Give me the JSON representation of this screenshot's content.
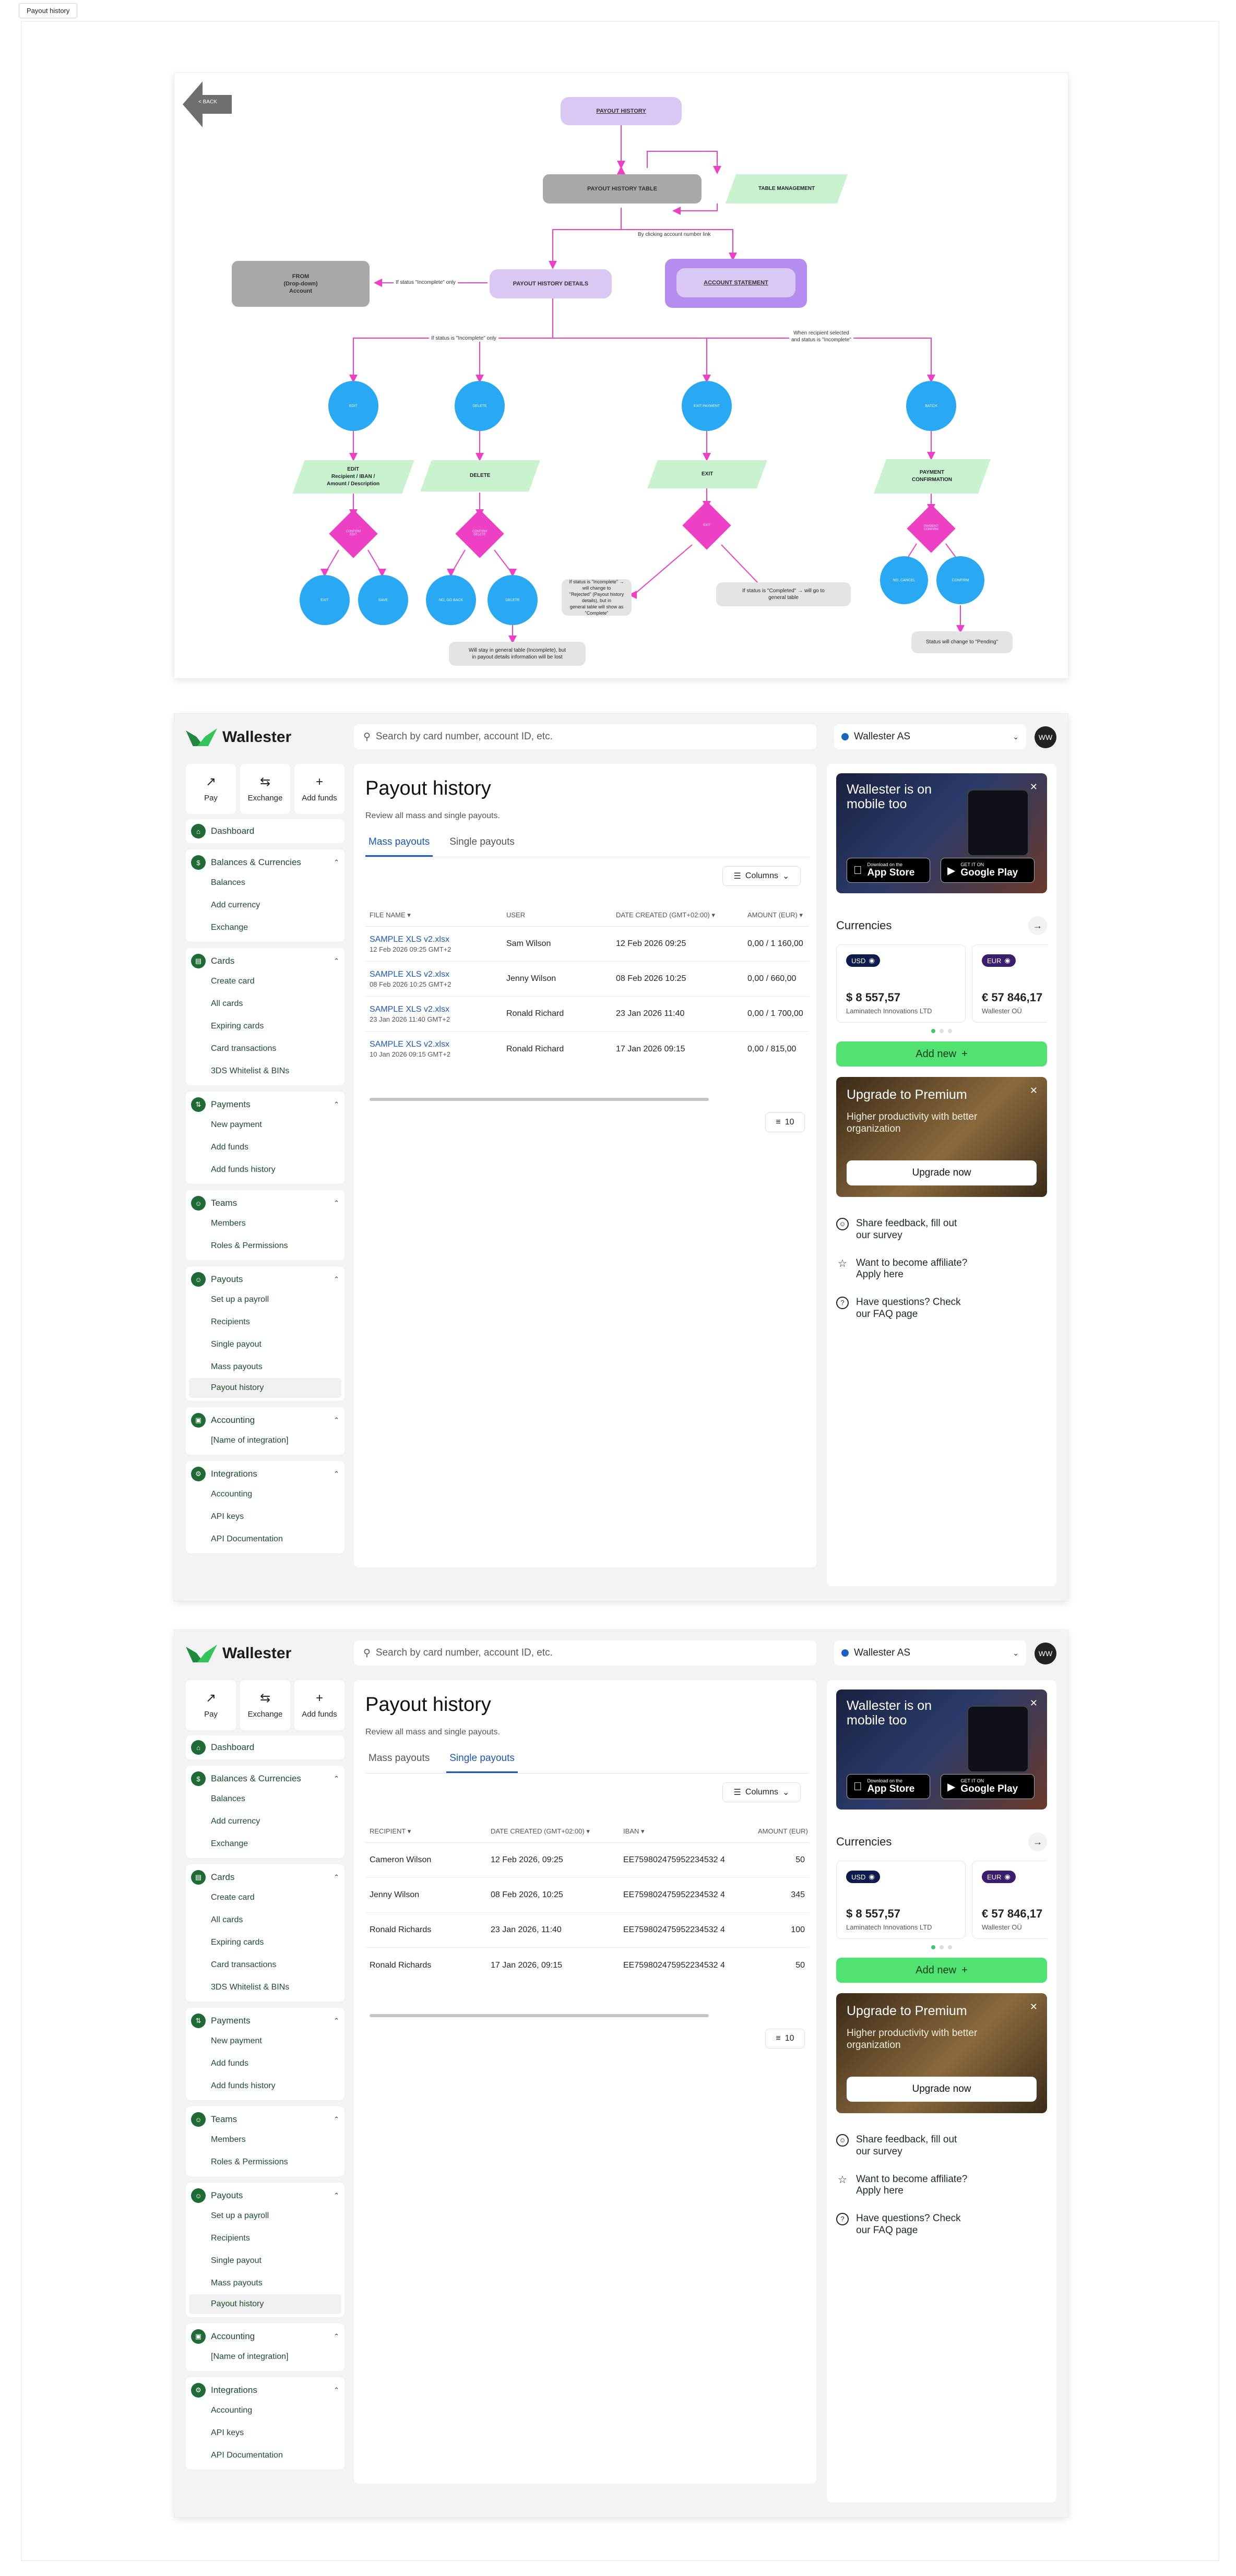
{
  "frame_label": "Payout history",
  "flow": {
    "back": "< BACK",
    "payout_history": "PAYOUT HISTORY",
    "payout_history_table": "PAYOUT HISTORY TABLE",
    "table_management": "TABLE MANAGEMENT",
    "by_clicking": "By clicking account number link",
    "from": "FROM\n(Drop-down)\nAccount",
    "if_incomplete_only": "If status \"Incomplete\" only",
    "payout_history_details": "PAYOUT HISTORY DETAILS",
    "account_statement": "ACCOUNT STATEMENT",
    "if_incomplete_only_2": "If status is \"Incomplete\" only",
    "when_recipient": "When recipient selected\nand status is \"Incomplete\"",
    "circles": [
      "EDIT",
      "DELETE",
      "EXIT PAYMENT",
      "BATCH"
    ],
    "edit_box": "EDIT\nRecipient / IBAN /\nAmount / Description",
    "delete_box": "DELETE",
    "exit_box": "EXIT",
    "payment_confirmation": "PAYMENT\nCONFIRMATION",
    "diamonds": [
      "CONFIRM\nEDIT",
      "CONFIRM\nDELETE",
      "EXIT",
      "PAYMENT\nCONFIRM"
    ],
    "bottom_circles": [
      "EXIT",
      "SAVE",
      "NO, GO BACK",
      "DELETE",
      "NO, CANCEL",
      "CONFIRM"
    ],
    "note_delete": "Will stay in general table (Incomplete), but\nin payout details information will be lost",
    "note_exit_incomplete": "If status is \"Incomplete\" → will change to\n\"Rejected\" (Payout history details), but in\ngeneral table will show as \"Complete\"",
    "note_exit_completed": "If status is \"Completed\" → will go to\ngeneral table",
    "note_pending": "Status will change to \"Pending\""
  },
  "app": {
    "brand": "Wallester",
    "search_placeholder": "Search by card number, account ID, etc.",
    "company": "Wallester AS",
    "avatar": "WW",
    "quick": [
      "Pay",
      "Exchange",
      "Add funds"
    ],
    "nav": {
      "dashboard": "Dashboard",
      "balances": "Balances & Currencies",
      "balances_items": [
        "Balances",
        "Add currency",
        "Exchange"
      ],
      "cards": "Cards",
      "cards_items": [
        "Create card",
        "All cards",
        "Expiring cards",
        "Card transactions",
        "3DS Whitelist & BINs"
      ],
      "payments": "Payments",
      "payments_items": [
        "New payment",
        "Add funds",
        "Add funds history"
      ],
      "teams": "Teams",
      "teams_items": [
        "Members",
        "Roles & Permissions"
      ],
      "payouts": "Payouts",
      "payouts_items": [
        "Set up a payroll",
        "Recipients",
        "Single payout",
        "Mass payouts",
        "Payout history"
      ],
      "accounting": "Accounting",
      "accounting_items": [
        "[Name of integration]"
      ],
      "integrations": "Integrations",
      "integrations_items": [
        "Accounting",
        "API keys",
        "API Documentation"
      ]
    },
    "page_title": "Payout history",
    "page_sub": "Review all mass and single payouts.",
    "tab_mass": "Mass payouts",
    "tab_single": "Single payouts",
    "columns": "Columns",
    "page_size": "10",
    "mass_headers": [
      "FILE NAME",
      "USER",
      "DATE CREATED (GMT+02:00)",
      "AMOUNT (EUR)"
    ],
    "mass_rows": [
      {
        "file": "SAMPLE XLS v2.xlsx",
        "date_small": "12 Feb 2026 09:25 GMT+2",
        "user": "Sam Wilson",
        "date": "12 Feb 2026 09:25",
        "amount": "0,00 / 1 160,00"
      },
      {
        "file": "SAMPLE XLS v2.xlsx",
        "date_small": "08 Feb 2026 10:25 GMT+2",
        "user": "Jenny Wilson",
        "date": "08 Feb 2026 10:25",
        "amount": "0,00 / 660,00"
      },
      {
        "file": "SAMPLE XLS v2.xlsx",
        "date_small": "23 Jan 2026 11:40 GMT+2",
        "user": "Ronald Richard",
        "date": "23 Jan 2026 11:40",
        "amount": "0,00 / 1 700,00"
      },
      {
        "file": "SAMPLE XLS v2.xlsx",
        "date_small": "10 Jan 2026 09:15 GMT+2",
        "user": "Ronald Richard",
        "date": "17 Jan 2026 09:15",
        "amount": "0,00 / 815,00"
      }
    ],
    "single_headers": [
      "RECIPIENT",
      "DATE CREATED (GMT+02:00)",
      "IBAN",
      "AMOUNT (EUR)"
    ],
    "single_rows": [
      {
        "recipient": "Cameron Wilson",
        "date": "12 Feb 2026, 09:25",
        "iban": "EE759802475952234532 4",
        "amount": "50"
      },
      {
        "recipient": "Jenny Wilson",
        "date": "08 Feb 2026, 10:25",
        "iban": "EE759802475952234532 4",
        "amount": "345"
      },
      {
        "recipient": "Ronald Richards",
        "date": "23 Jan 2026, 11:40",
        "iban": "EE759802475952234532 4",
        "amount": "100"
      },
      {
        "recipient": "Ronald Richards",
        "date": "17 Jan 2026, 09:15",
        "iban": "EE759802475952234532 4",
        "amount": "50"
      }
    ],
    "promo_title": "Wallester is on mobile too",
    "app_store_top": "Download on the",
    "app_store": "App Store",
    "play_top": "GET IT ON",
    "play": "Google Play",
    "currencies": "Currencies",
    "cur_cards": [
      {
        "code": "USD",
        "amount": "$ 8 557,57",
        "name": "Laminatech Innovations LTD"
      },
      {
        "code": "EUR",
        "amount": "€ 57 846,17",
        "name": "Wallester OÜ"
      }
    ],
    "add_new": "Add new",
    "premium_title": "Upgrade to Premium",
    "premium_text": "Higher productivity with better organization",
    "upgrade": "Upgrade now",
    "links": [
      "Share feedback, fill out our survey",
      "Want to become affiliate? Apply here",
      "Have questions? Check our FAQ page"
    ]
  }
}
